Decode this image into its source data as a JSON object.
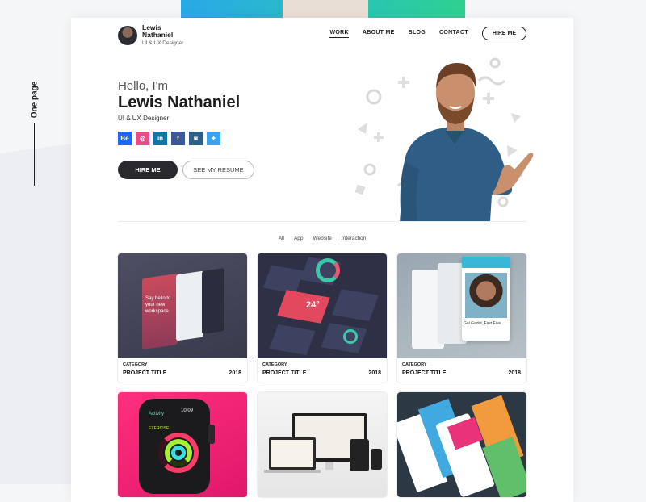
{
  "side_label": "One page",
  "header": {
    "name_line1": "Lewis",
    "name_line2": "Nathaniel",
    "role": "UI & UX Designer",
    "nav": [
      {
        "label": "WORK",
        "active": true
      },
      {
        "label": "ABOUT ME",
        "active": false
      },
      {
        "label": "BLOG",
        "active": false
      },
      {
        "label": "CONTACT",
        "active": false
      }
    ],
    "hire_button": "HIRE ME"
  },
  "hero": {
    "greeting": "Hello, I'm",
    "name": "Lewis Nathaniel",
    "role": "UI & UX Designer",
    "socials": [
      {
        "icon": "behance-icon",
        "glyph": "Bē",
        "color": "#1769ff"
      },
      {
        "icon": "dribbble-icon",
        "glyph": "◎",
        "color": "#ea4c89"
      },
      {
        "icon": "linkedin-icon",
        "glyph": "in",
        "color": "#0e76a8"
      },
      {
        "icon": "facebook-icon",
        "glyph": "f",
        "color": "#3b5998"
      },
      {
        "icon": "instagram-icon",
        "glyph": "◙",
        "color": "#2c5f8a"
      },
      {
        "icon": "twitter-icon",
        "glyph": "✦",
        "color": "#3aa2f0"
      }
    ],
    "primary_button": "HIRE ME",
    "secondary_button": "SEE MY RESUME"
  },
  "filters": [
    "All",
    "App",
    "Website",
    "Interaction"
  ],
  "projects": [
    {
      "category": "CATEGORY",
      "title": "PROJECT TITLE",
      "year": "2018",
      "image_text": "Say hello to your new workspace"
    },
    {
      "category": "CATEGORY",
      "title": "PROJECT TITLE",
      "year": "2018",
      "image_text": "24°"
    },
    {
      "category": "CATEGORY",
      "title": "PROJECT TITLE",
      "year": "2018",
      "image_text": "Gal Gadot, Fast Five"
    },
    {
      "category": "",
      "title": "",
      "year": "",
      "image_text": "Activity"
    },
    {
      "category": "",
      "title": "",
      "year": "",
      "image_text": ""
    },
    {
      "category": "",
      "title": "",
      "year": "",
      "image_text": ""
    }
  ],
  "watch_labels": {
    "time": "10:09",
    "exercise": "EXERCISE"
  },
  "colors": {
    "dark": "#2a2a2e",
    "accent_blue": "#2aa8e8",
    "accent_green": "#2ed08f",
    "pink": "#e8327a"
  }
}
